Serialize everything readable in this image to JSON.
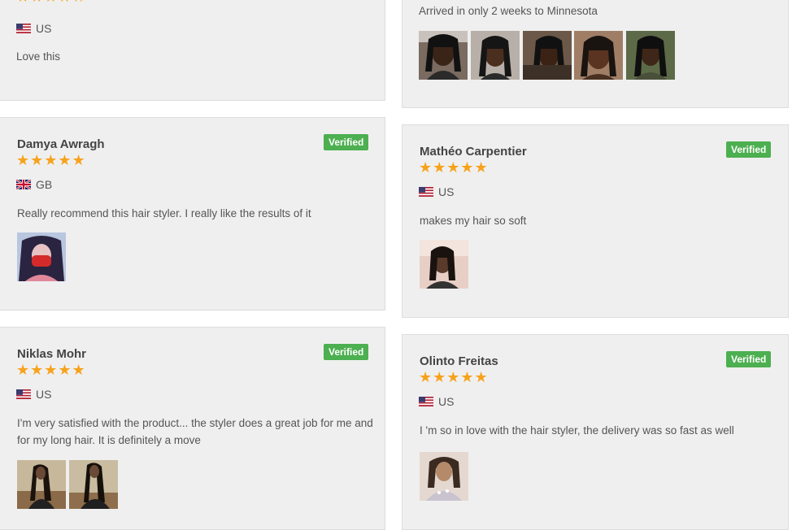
{
  "reviews": [
    {
      "stars": "★★★★☆",
      "country": "US",
      "text": "Love this"
    },
    {
      "text": "Arrived in only 2 weeks to Minnesota"
    },
    {
      "name": "Damya Awragh",
      "verified": "Verified",
      "stars": "★★★★★",
      "country": "GB",
      "text": "Really recommend this hair styler. I really like the results of it"
    },
    {
      "name": "Mathéo Carpentier",
      "verified": "Verified",
      "stars": "★★★★★",
      "country": "US",
      "text": "makes my hair so soft"
    },
    {
      "name": "Niklas Mohr",
      "verified": "Verified",
      "stars": "★★★★★",
      "country": "US",
      "text": "I'm very satisfied with the product... the styler does a great job for me and for my long hair. It is definitely a move"
    },
    {
      "name": "Olinto Freitas",
      "verified": "Verified",
      "stars": "★★★★★",
      "country": "US",
      "text": "I 'm so in love with the hair styler, the delivery was so fast as well"
    }
  ],
  "colors": {
    "accent_star": "#f7a21b",
    "verified_green": "#4caf50",
    "card_bg": "#efefef"
  }
}
